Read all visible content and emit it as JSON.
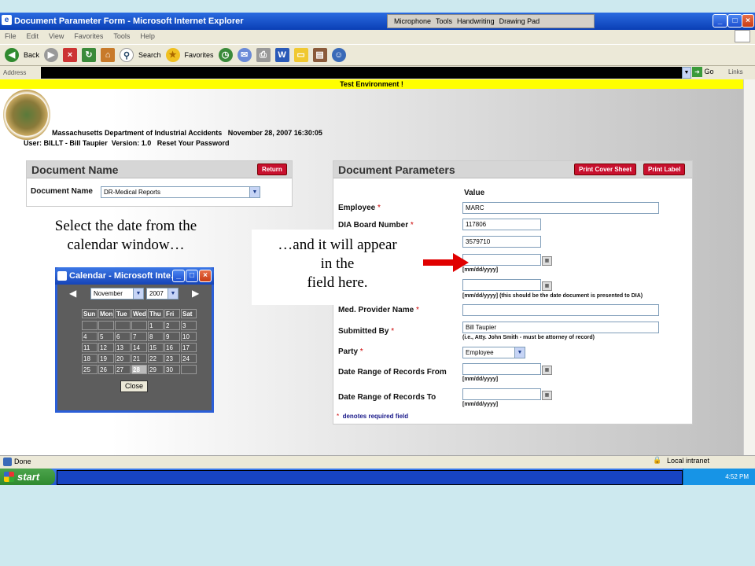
{
  "window": {
    "title": "Document Parameter Form - Microsoft Internet Explorer",
    "lang_bar": [
      "Microphone",
      "Tools",
      "Handwriting",
      "Drawing Pad"
    ]
  },
  "menu": [
    "File",
    "Edit",
    "View",
    "Favorites",
    "Tools",
    "Help"
  ],
  "toolbar": {
    "back": "Back",
    "search": "Search",
    "favorites": "Favorites"
  },
  "address": {
    "label": "Address",
    "go": "Go",
    "links": "Links"
  },
  "banner": "Test Environment !",
  "header": {
    "agency": "Massachusetts Department of Industrial Accidents",
    "datetime": "November 28, 2007 16:30:05",
    "user_label": "User:",
    "user": "BILLT - Bill Taupier",
    "version": "Version: 1.0",
    "reset": "Reset Your Password"
  },
  "doc_name_panel": {
    "title": "Document Name",
    "return_btn": "Return",
    "label": "Document Name",
    "value": "DR-Medical Reports"
  },
  "params_panel": {
    "title": "Document Parameters",
    "print_cover": "Print Cover Sheet",
    "print_label": "Print Label",
    "value_col": "Value",
    "fields": {
      "employee": {
        "label": "Employee",
        "value": "MARC"
      },
      "dia": {
        "label": "DIA Board Number",
        "value": "117806"
      },
      "third": {
        "value": "3579710"
      },
      "date1_hint": "[mm/dd/yyyy]",
      "date2_hint": "[mm/dd/yyyy] (this should be the date document is presented to DIA)",
      "provider": {
        "label": "Med. Provider Name"
      },
      "submitted": {
        "label": "Submitted By",
        "value": "Bill Taupier",
        "hint": "(i.e., Atty. John Smith - must be attorney of record)"
      },
      "party": {
        "label": "Party",
        "value": "Employee"
      },
      "range_from": {
        "label": "Date Range of Records From",
        "hint": "[mm/dd/yyyy]"
      },
      "range_to": {
        "label": "Date Range of Records To",
        "hint": "[mm/dd/yyyy]"
      }
    },
    "required_note": "denotes required field",
    "req_mark": "*"
  },
  "captions": {
    "left": "Select the date from the calendar window…",
    "box_line1": "…and it will appear",
    "box_line2": "in the",
    "box_line3": "field here."
  },
  "calendar": {
    "title": "Calendar - Microsoft Inte…",
    "month": "November",
    "year": "2007",
    "days": [
      "Sun",
      "Mon",
      "Tue",
      "Wed",
      "Thu",
      "Fri",
      "Sat"
    ],
    "weeks": [
      [
        "",
        "",
        "",
        "",
        "1",
        "2",
        "3"
      ],
      [
        "4",
        "5",
        "6",
        "7",
        "8",
        "9",
        "10"
      ],
      [
        "11",
        "12",
        "13",
        "14",
        "15",
        "16",
        "17"
      ],
      [
        "18",
        "19",
        "20",
        "21",
        "22",
        "23",
        "24"
      ],
      [
        "25",
        "26",
        "27",
        "28",
        "29",
        "30",
        ""
      ]
    ],
    "selected": "28",
    "close": "Close"
  },
  "status": {
    "done": "Done",
    "zone": "Local intranet"
  },
  "taskbar": {
    "start": "start",
    "clock": "4:52 PM"
  },
  "colors": {
    "accent_red": "#c8102e",
    "titlebar": "#0a3fb5",
    "banner": "#ffff00"
  }
}
